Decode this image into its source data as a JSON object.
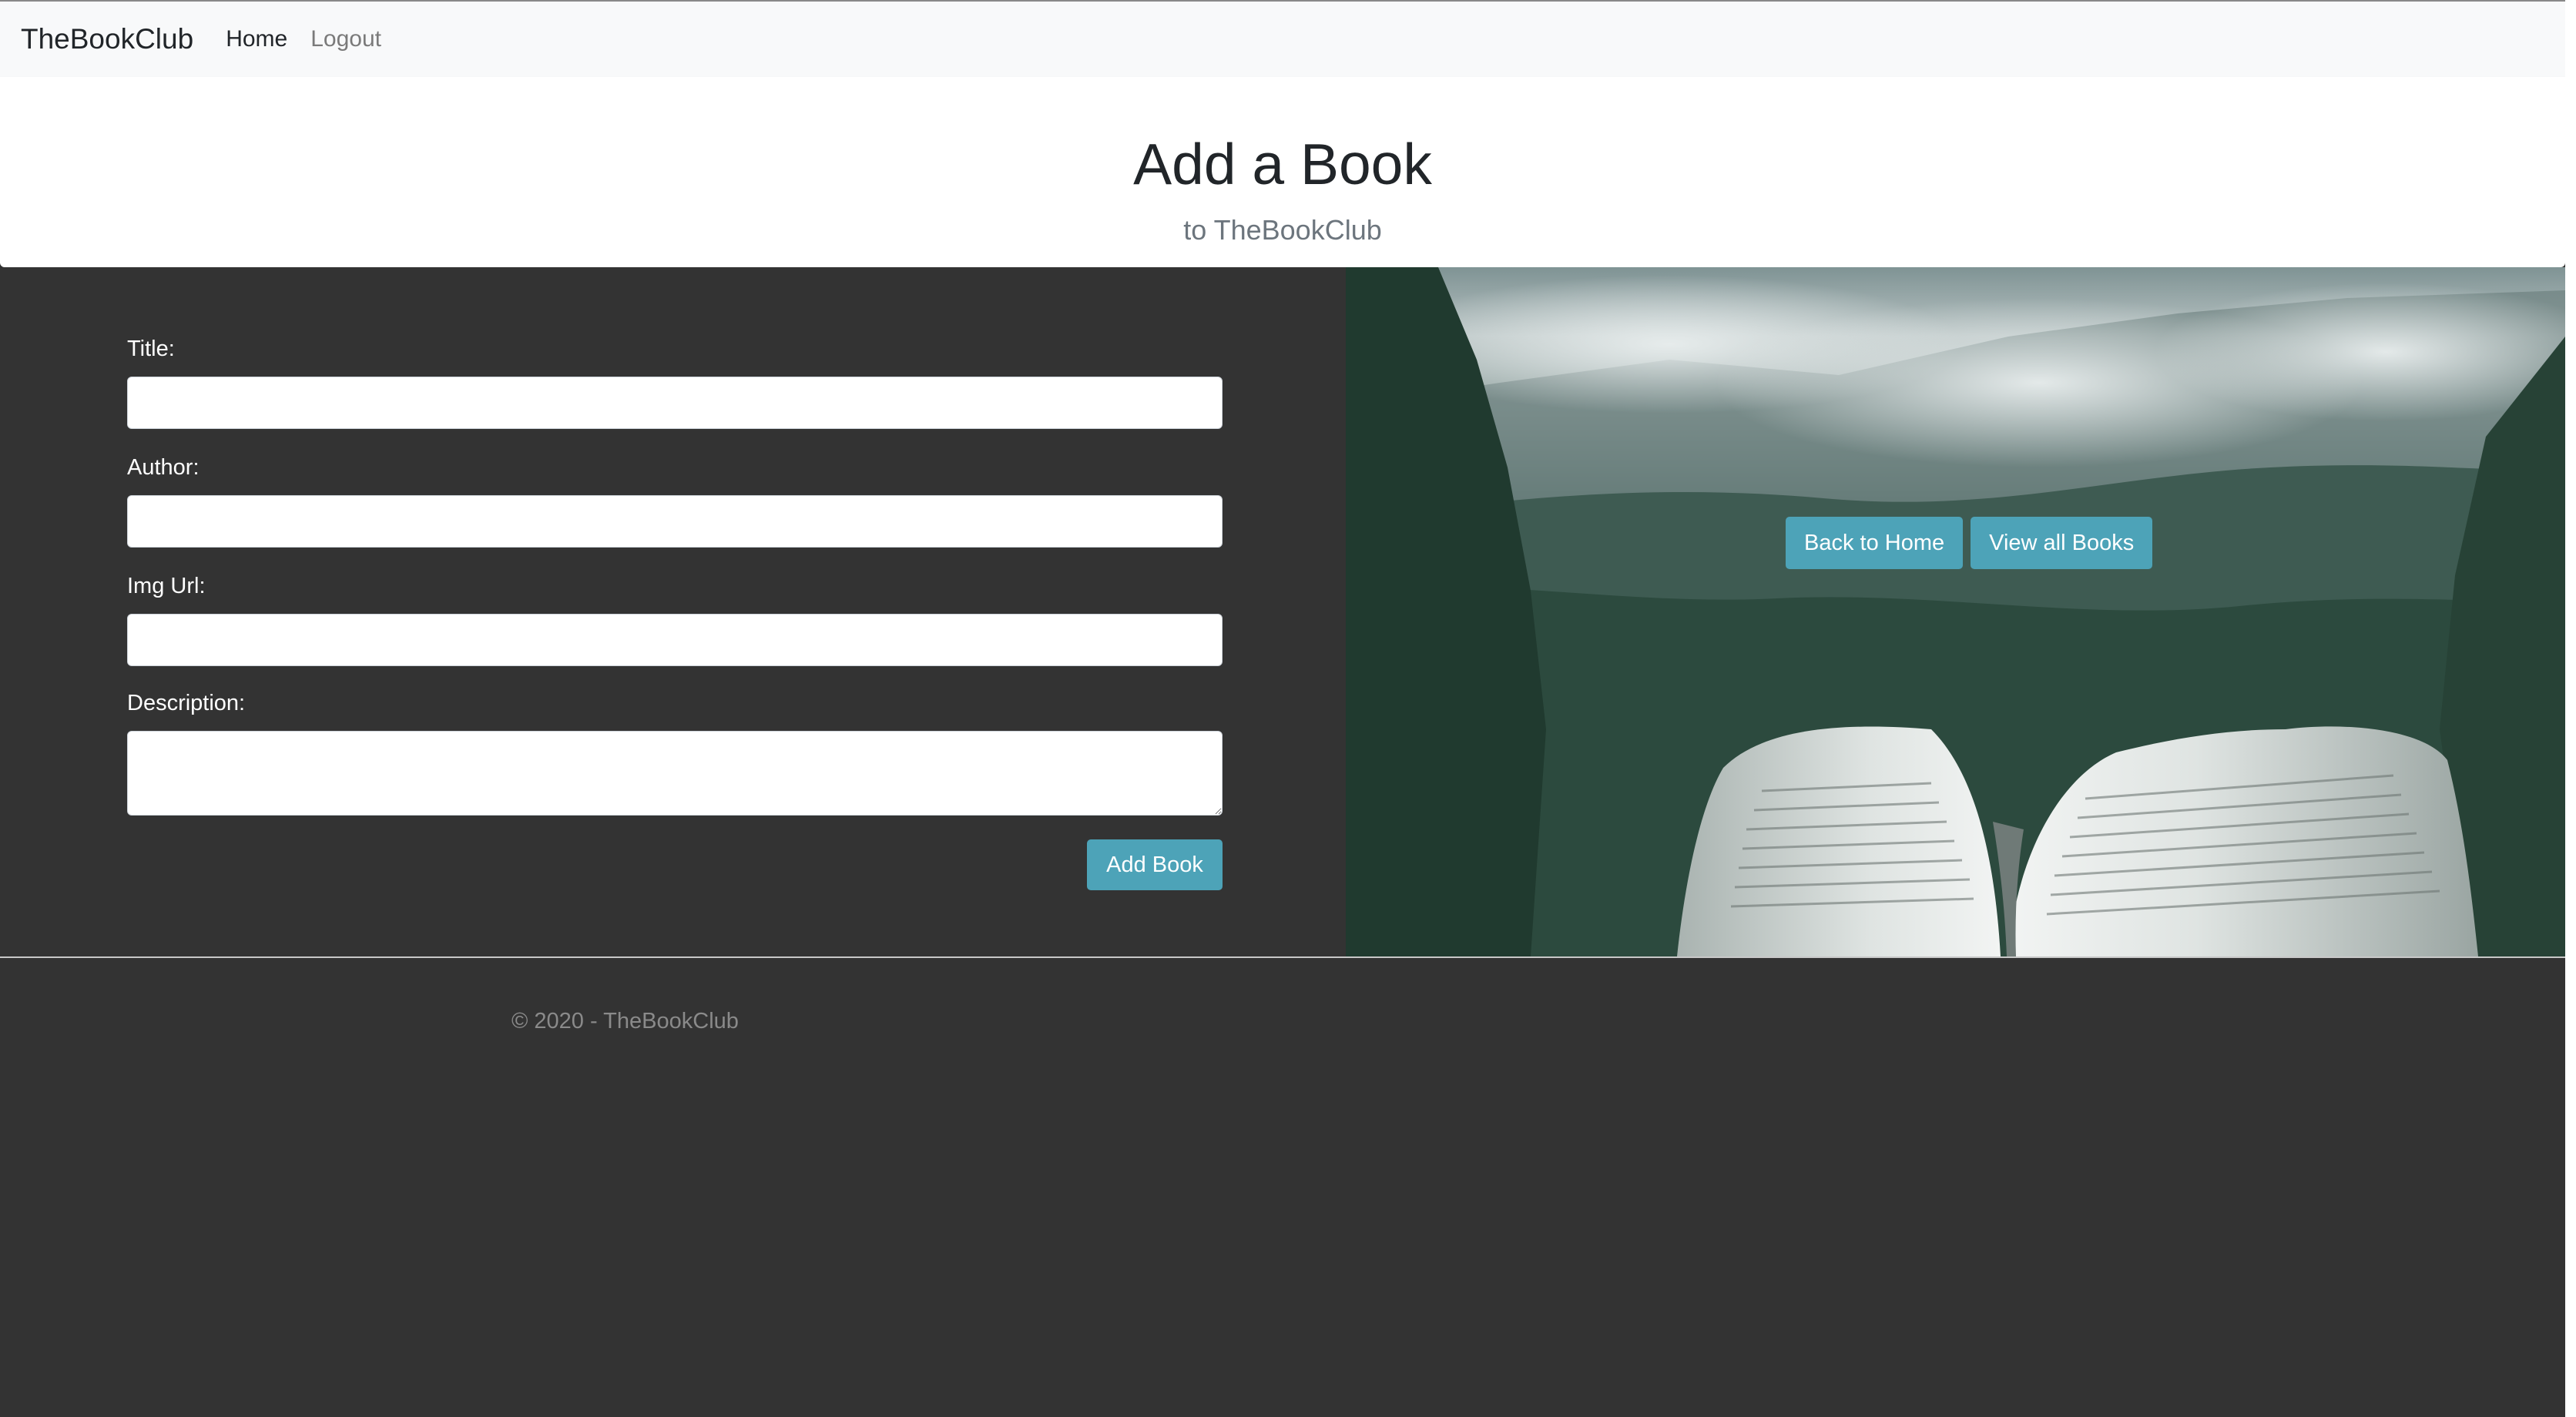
{
  "navbar": {
    "brand": "TheBookClub",
    "links": [
      {
        "label": "Home"
      },
      {
        "label": "Logout"
      }
    ]
  },
  "header": {
    "title": "Add a Book",
    "subtitle": "to TheBookClub"
  },
  "form": {
    "fields": [
      {
        "label": "Title:",
        "value": "",
        "placeholder": ""
      },
      {
        "label": "Author:",
        "value": "",
        "placeholder": ""
      },
      {
        "label": "Img Url:",
        "value": "",
        "placeholder": ""
      },
      {
        "label": "Description:",
        "value": "",
        "placeholder": ""
      }
    ],
    "submit_label": "Add Book"
  },
  "image_panel": {
    "buttons": [
      {
        "label": "Back to Home"
      },
      {
        "label": "View all Books"
      }
    ]
  },
  "footer": {
    "text": "© 2020 - TheBookClub"
  },
  "colors": {
    "page_background": "#333333",
    "navbar_background": "#f8f9fa",
    "button_info": "#4da3b8"
  }
}
